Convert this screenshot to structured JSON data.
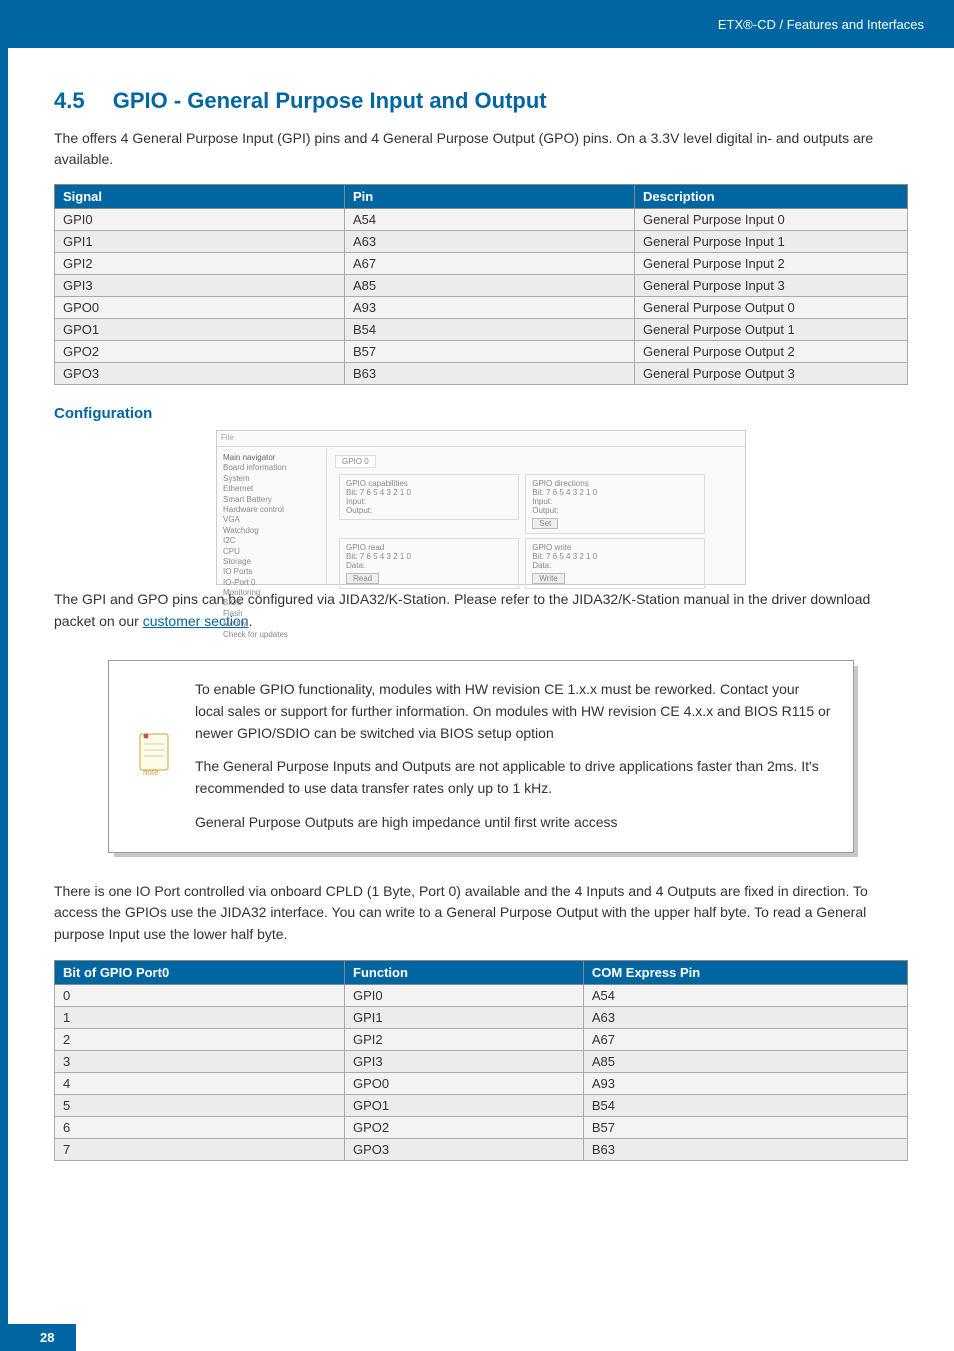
{
  "header": {
    "breadcrumb": "ETX®-CD / Features and Interfaces"
  },
  "section": {
    "number": "4.5",
    "title": "GPIO - General Purpose Input and Output",
    "intro": "The offers 4 General Purpose Input (GPI) pins and 4 General Purpose Output (GPO) pins. On a 3.3V level digital in- and outputs are available."
  },
  "table1": {
    "headers": [
      "Signal",
      "Pin",
      "Description"
    ],
    "rows": [
      [
        "GPI0",
        "A54",
        "General Purpose Input 0"
      ],
      [
        "GPI1",
        "A63",
        "General Purpose Input 1"
      ],
      [
        "GPI2",
        "A67",
        "General Purpose Input 2"
      ],
      [
        "GPI3",
        "A85",
        "General Purpose Input 3"
      ],
      [
        "GPO0",
        "A93",
        "General Purpose Output 0"
      ],
      [
        "GPO1",
        "B54",
        "General Purpose Output 1"
      ],
      [
        "GPO2",
        "B57",
        "General Purpose Output 2"
      ],
      [
        "GPO3",
        "B63",
        "General Purpose Output 3"
      ]
    ]
  },
  "configuration": {
    "heading": "Configuration",
    "image": {
      "topbar": "File",
      "nav_title": "Main navigator",
      "gpio_tab": "GPIO 0",
      "tree": [
        "Board information",
        "System",
        "Ethernet",
        "Smart Battery",
        "Hardware control",
        "VGA",
        "Watchdog",
        "I2C",
        "CPU",
        "Storage",
        "IO Ports",
        "IO-Port 0",
        "Monitoring",
        "BIOS",
        "Flash",
        "Modify",
        "Check for updates"
      ],
      "groups": {
        "g1_title": "GPIO capabilities",
        "g1_bit": "Bit:     7 6 5 4 3 2 1 0",
        "g1_input": "Input:",
        "g1_output": "Output:",
        "g2_title": "GPIO directions",
        "g2_bit": "Bit:     7 6 5 4 3 2 1 0",
        "g2_input": "Input:",
        "g2_output": "Output:",
        "g2_btn": "Set",
        "g3_title": "GPIO read",
        "g3_bit": "Bit:     7 6 5 4 3 2 1 0",
        "g3_data": "Data:",
        "g3_btn": "Read",
        "g4_title": "GPIO write",
        "g4_bit": "Bit:     7 6 5 4 3 2 1 0",
        "g4_data": "Data:",
        "g4_btn": "Write"
      }
    },
    "caption_pre": "The GPI and GPO pins can be configured via JIDA32/K-Station. Please refer to the JIDA32/K-Station manual in the driver download packet on our ",
    "caption_link": "customer section",
    "caption_post": "."
  },
  "note": {
    "p1": "To enable GPIO functionality, modules with HW revision CE 1.x.x must be reworked. Contact your local sales or support for further information. On modules with HW revision CE 4.x.x and BIOS R115 or newer GPIO/SDIO can be switched via BIOS setup option",
    "p2": "The General Purpose Inputs and Outputs are not applicable to drive applications faster than 2ms. It's recommended to use data transfer rates only up to 1 kHz.",
    "p3": "General Purpose Outputs are high impedance until first write access"
  },
  "para2": "There is one IO Port controlled via onboard CPLD (1 Byte, Port 0) available and the 4 Inputs and 4 Outputs are fixed in direction. To access the GPIOs use the JIDA32 interface. You can write to a General Purpose Output with the upper half byte. To read a General purpose Input use the lower half byte.",
  "table2": {
    "headers": [
      "Bit of GPIO Port0",
      "Function",
      "COM Express Pin"
    ],
    "rows": [
      [
        "0",
        "GPI0",
        "A54"
      ],
      [
        "1",
        "GPI1",
        "A63"
      ],
      [
        "2",
        "GPI2",
        "A67"
      ],
      [
        "3",
        "GPI3",
        "A85"
      ],
      [
        "4",
        "GPO0",
        "A93"
      ],
      [
        "5",
        "GPO1",
        "B54"
      ],
      [
        "6",
        "GPO2",
        "B57"
      ],
      [
        "7",
        "GPO3",
        "B63"
      ]
    ]
  },
  "footer": {
    "page": "28"
  }
}
